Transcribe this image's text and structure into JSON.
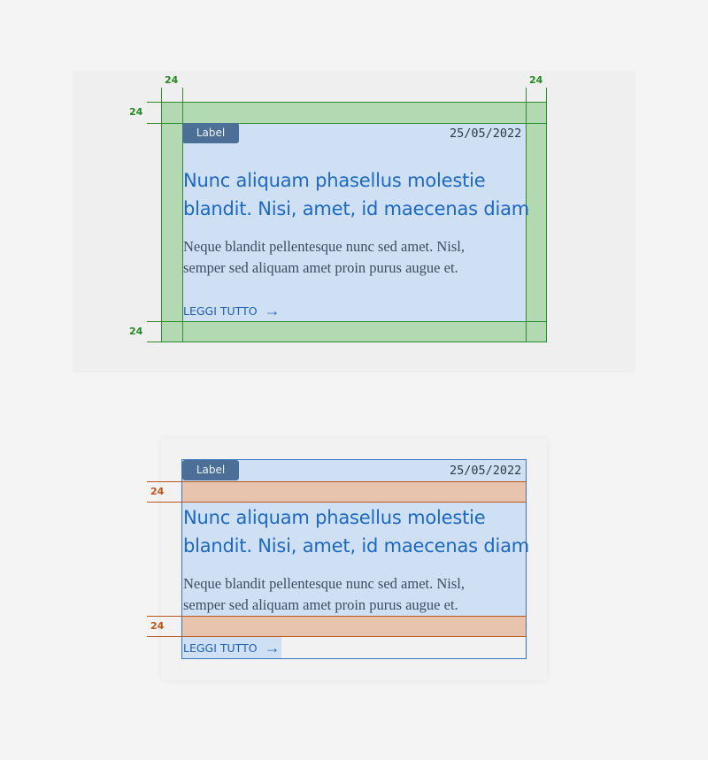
{
  "card": {
    "label": "Label",
    "date": "25/05/2022",
    "title_line1": "Nunc aliquam phasellus molestie",
    "title_line2": "blandit. Nisi, amet, id maecenas diam",
    "body_line1": "Neque blandit pellentesque nunc sed amet. Nisl,",
    "body_line2": "semper sed aliquam amet proin purus augue et.",
    "cta": "LEGGI TUTTO",
    "arrow": "→"
  },
  "annotations": {
    "padding_top": "24",
    "padding_left": "24",
    "padding_right": "24",
    "padding_bottom": "24",
    "gap_header": "24",
    "gap_footer": "24"
  },
  "colors": {
    "padding_green": "#b3d9b2",
    "gap_orange": "#e8c4ae",
    "content_blue": "#cfe0f5",
    "label_bg": "#4b6f96",
    "title": "#1b68c5"
  }
}
